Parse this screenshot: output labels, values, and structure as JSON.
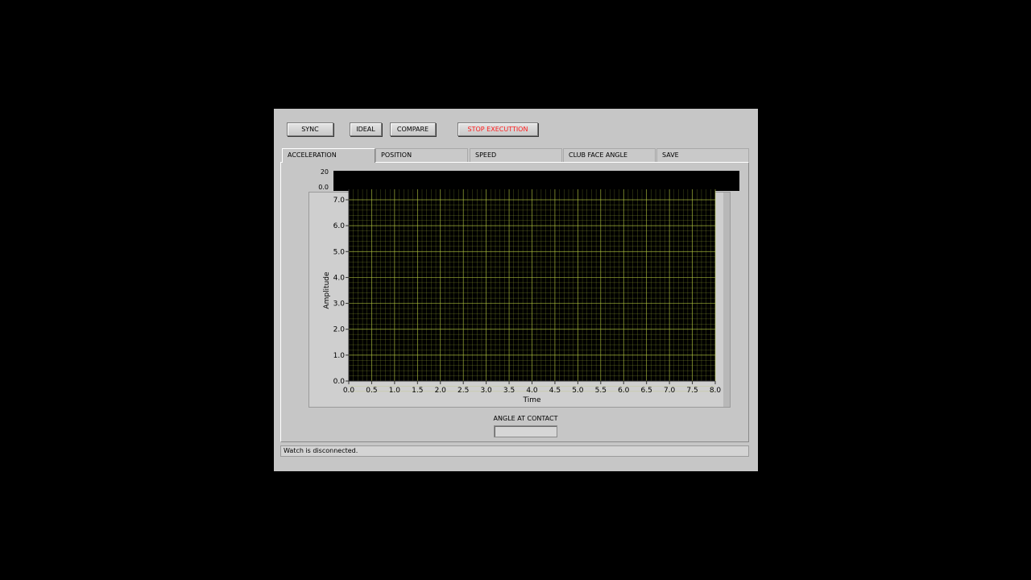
{
  "toolbar": {
    "sync": "SYNC",
    "ideal": "IDEAL",
    "compare": "COMPARE",
    "stop": "STOP EXECUTTION"
  },
  "tabs": [
    "ACCELERATION",
    "POSITION",
    "SPEED",
    "CLUB FACE ANGLE",
    "SAVE"
  ],
  "active_tab": "ACCELERATION",
  "top_strip": {
    "y_top": "20",
    "y_bottom": "0.0"
  },
  "chart_data": {
    "type": "line",
    "xlabel": "Time",
    "ylabel": "Amplitude",
    "xlim": [
      0,
      8
    ],
    "ylim": [
      0,
      7
    ],
    "x_ticks": [
      "0.0",
      "0.5",
      "1.0",
      "1.5",
      "2.0",
      "2.5",
      "3.0",
      "3.5",
      "4.0",
      "4.5",
      "5.0",
      "5.5",
      "6.0",
      "6.5",
      "7.0",
      "7.5",
      "8.0"
    ],
    "y_ticks": [
      "0.0",
      "1.0",
      "2.0",
      "3.0",
      "4.0",
      "5.0",
      "6.0",
      "7.0"
    ],
    "grid": true,
    "series": [],
    "colors": {
      "background": "#000000",
      "grid": "#b3c640"
    }
  },
  "angle_at_contact": {
    "label": "ANGLE AT CONTACT",
    "value": ""
  },
  "status": "Watch is disconnected."
}
